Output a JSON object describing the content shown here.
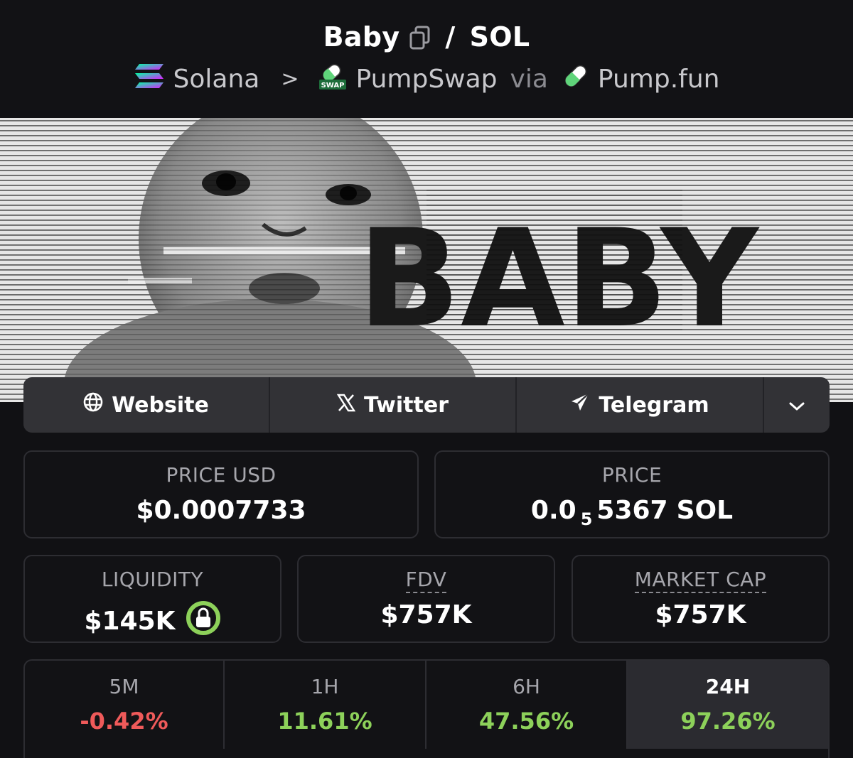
{
  "header": {
    "token": "Baby",
    "separator": "/",
    "quote": "SOL",
    "chain": "Solana",
    "chevron": ">",
    "dex": "PumpSwap",
    "via": "via",
    "launchpad": "Pump.fun",
    "icons": {
      "copy": "copy-icon",
      "chain": "solana-logo-icon",
      "dex": "pumpswap-logo-icon",
      "launchpad": "pill-icon"
    }
  },
  "banner": {
    "text": "BABY"
  },
  "links": [
    {
      "label": "Website",
      "icon": "globe-icon"
    },
    {
      "label": "Twitter",
      "icon": "x-logo-icon"
    },
    {
      "label": "Telegram",
      "icon": "telegram-icon"
    },
    {
      "label": "",
      "icon": "chevron-down-icon"
    }
  ],
  "stats": {
    "price_usd": {
      "label": "PRICE USD",
      "value": "$0.0007733"
    },
    "price_native": {
      "label": "PRICE",
      "prefix": "0.0",
      "zeros": "5",
      "digits": "5367",
      "unit": "SOL"
    },
    "liquidity": {
      "label": "LIQUIDITY",
      "value": "$145K",
      "icon": "locked-liquidity-icon"
    },
    "fdv": {
      "label": "FDV",
      "value": "$757K"
    },
    "market_cap": {
      "label": "MARKET CAP",
      "value": "$757K"
    }
  },
  "changes": [
    {
      "period": "5M",
      "value": "-0.42%",
      "trend": "negative"
    },
    {
      "period": "1H",
      "value": "11.61%",
      "trend": "positive"
    },
    {
      "period": "6H",
      "value": "47.56%",
      "trend": "positive"
    },
    {
      "period": "24H",
      "value": "97.26%",
      "trend": "positive",
      "selected": true
    }
  ],
  "colors": {
    "background": "#111114",
    "card": "#121215",
    "border": "#2d2d32",
    "link_bar": "#323236",
    "positive": "#8dd15a",
    "negative": "#ef5a5a",
    "muted": "#a6a6ac"
  }
}
